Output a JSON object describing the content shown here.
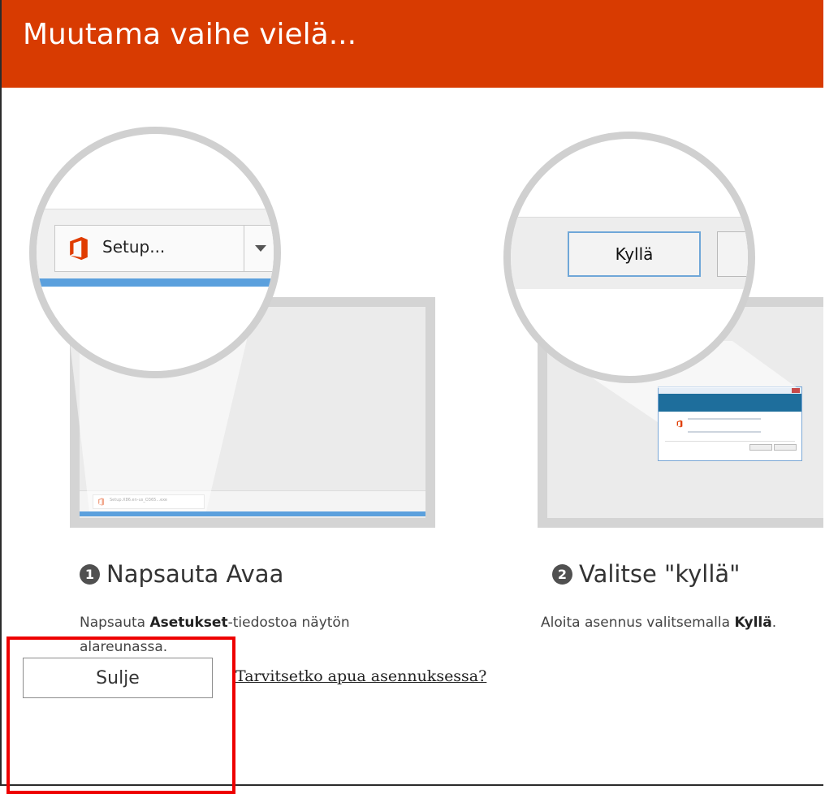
{
  "dialog": {
    "title": "Muutama vaihe vielä..."
  },
  "step1": {
    "number": "1",
    "title": "Napsauta Avaa",
    "desc_prefix": "Napsauta ",
    "desc_bold": "Asetukset",
    "desc_suffix": "-tiedostoa näytön",
    "desc_line2": "alareunassa.",
    "magnifier_label": "Setup...",
    "taskbar_label": "Setup.X86.en-us_O365...exe"
  },
  "step2": {
    "number": "2",
    "title": "Valitse \"kyllä\"",
    "desc_prefix": "Aloita asennus valitsemalla ",
    "desc_bold": "Kyllä",
    "desc_suffix": ".",
    "magnifier_yes": "Kyllä"
  },
  "footer": {
    "close_label": "Sulje",
    "help_link": "Tarvitsetko apua asennuksessa?"
  },
  "colors": {
    "header": "#d83b01",
    "highlight": "#ee0000",
    "office_icon": "#e03c00",
    "accent_blue": "#5ba0dd"
  },
  "icons": [
    "office-logo-icon",
    "chevron-down-icon",
    "step-number-icon"
  ]
}
